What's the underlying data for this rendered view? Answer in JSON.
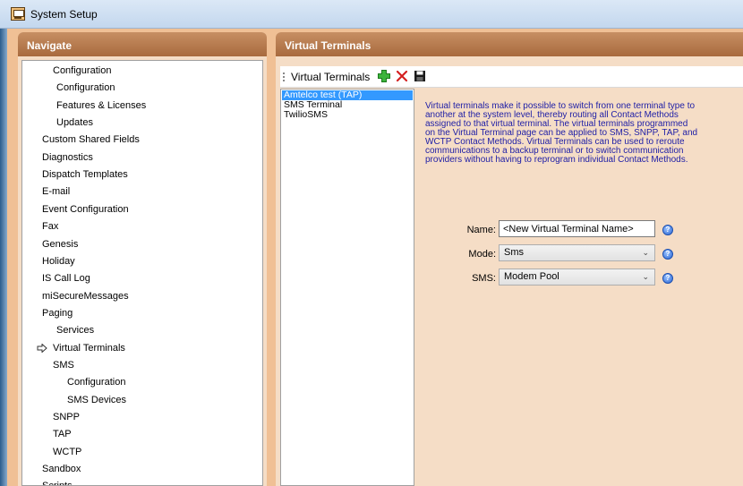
{
  "window": {
    "title": "System Setup"
  },
  "nav": {
    "header": "Navigate",
    "items": [
      {
        "label": "Configuration",
        "depth": 1
      },
      {
        "label": "Configuration",
        "depth": 2
      },
      {
        "label": "Features & Licenses",
        "depth": 2
      },
      {
        "label": "Updates",
        "depth": 2
      },
      {
        "label": "Custom Shared Fields",
        "depth": 0
      },
      {
        "label": "Diagnostics",
        "depth": 0
      },
      {
        "label": "Dispatch Templates",
        "depth": 0
      },
      {
        "label": "E-mail",
        "depth": 0
      },
      {
        "label": "Event Configuration",
        "depth": 0
      },
      {
        "label": "Fax",
        "depth": 0
      },
      {
        "label": "Genesis",
        "depth": 0
      },
      {
        "label": "Holiday",
        "depth": 0
      },
      {
        "label": "IS Call Log",
        "depth": 0
      },
      {
        "label": "miSecureMessages",
        "depth": 0
      },
      {
        "label": "Paging",
        "depth": 0
      },
      {
        "label": "Services",
        "depth": 2
      },
      {
        "label": "Virtual Terminals",
        "depth": 1,
        "current": true
      },
      {
        "label": "SMS",
        "depth": 1
      },
      {
        "label": "Configuration",
        "depth": 3
      },
      {
        "label": "SMS Devices",
        "depth": 3
      },
      {
        "label": "SNPP",
        "depth": 1
      },
      {
        "label": "TAP",
        "depth": 1
      },
      {
        "label": "WCTP",
        "depth": 1
      },
      {
        "label": "Sandbox",
        "depth": 0
      },
      {
        "label": "Scripts",
        "depth": 0
      }
    ]
  },
  "virtual_terminals": {
    "header": "Virtual Terminals",
    "toolbar": {
      "label": "Virtual Terminals",
      "add_icon": "plus-icon",
      "delete_icon": "x-icon",
      "save_icon": "floppy-disk-icon"
    },
    "list": [
      {
        "label": "Amtelco test (TAP)",
        "selected": true
      },
      {
        "label": "SMS Terminal",
        "selected": false
      },
      {
        "label": "TwilioSMS",
        "selected": false
      }
    ],
    "description": "Virtual terminals make it possible to switch from one terminal type to another at the system level, thereby routing all Contact Methods assigned to that virtual terminal. The virtual terminals programmed on the Virtual Terminal page can be applied to SMS, SNPP, TAP, and WCTP Contact Methods. Virtual Terminals can be used to reroute communications to a backup terminal or to switch communication providers without having to reprogram individual Contact Methods.",
    "form": {
      "name_label": "Name:",
      "name_value": "<New Virtual Terminal Name>",
      "mode_label": "Mode:",
      "mode_value": "Sms",
      "sms_label": "SMS:",
      "sms_value": "Modem Pool"
    }
  },
  "colors": {
    "header_bg": "#b07345",
    "panel_bg": "#f5ddc6",
    "selection": "#3399ff",
    "description_text": "#1d1da6"
  }
}
